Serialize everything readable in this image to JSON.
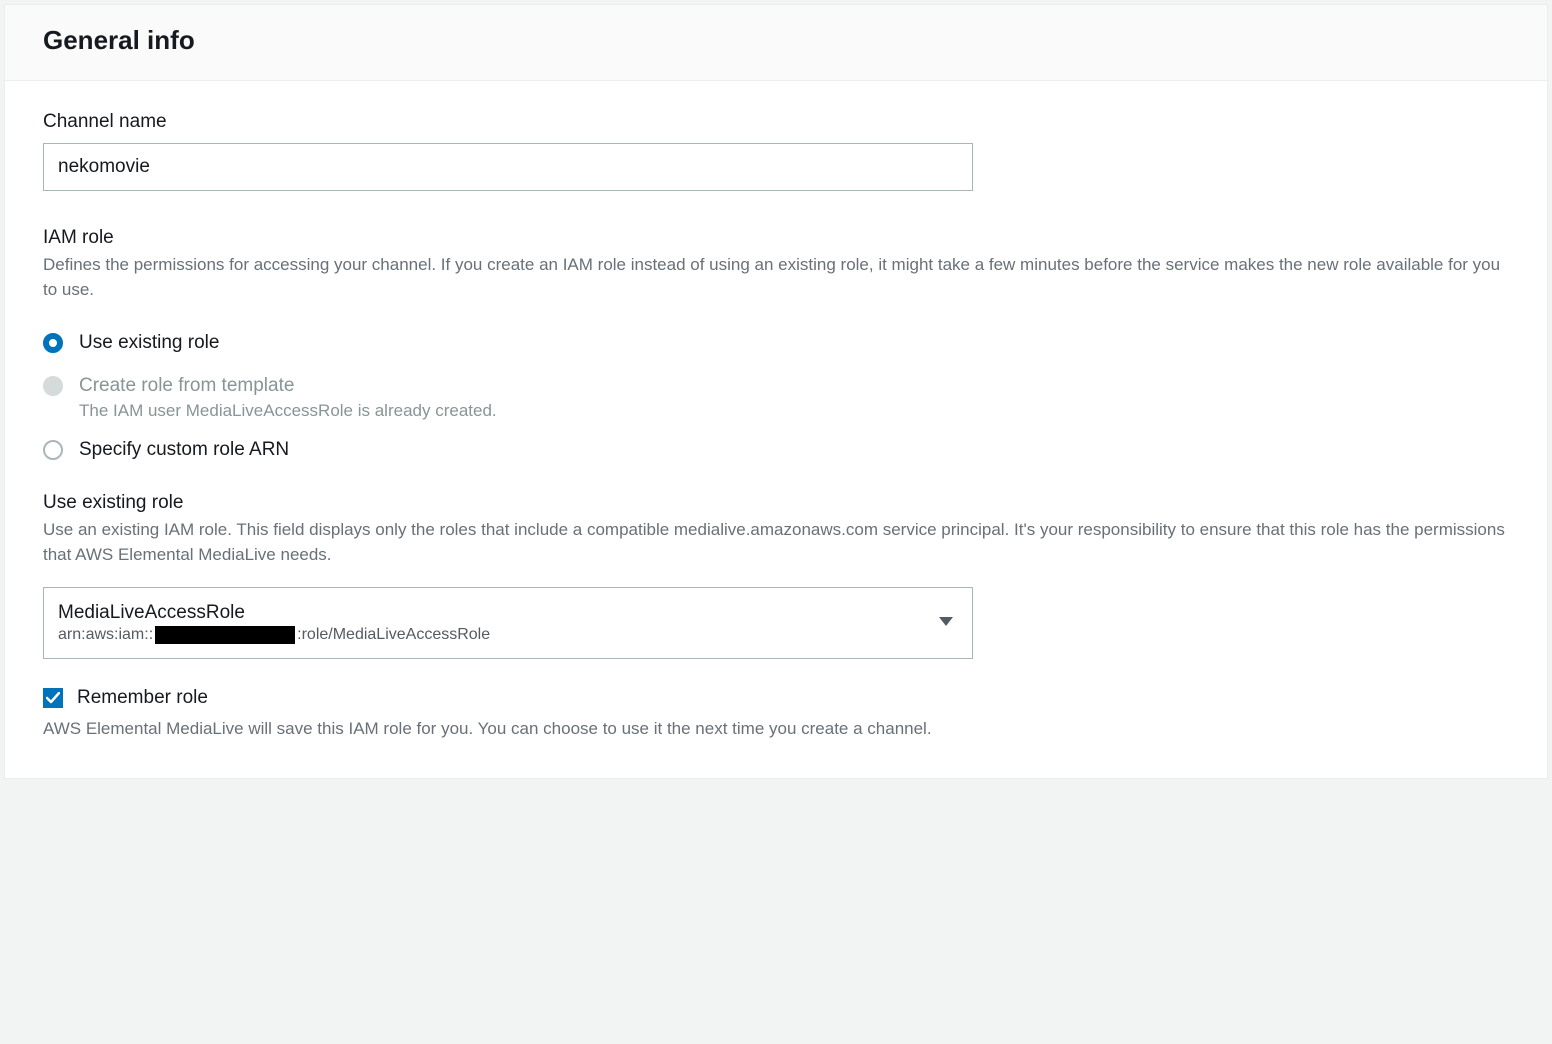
{
  "header": {
    "title": "General info"
  },
  "channel_name": {
    "label": "Channel name",
    "value": "nekomovie"
  },
  "iam_role": {
    "label": "IAM role",
    "description": "Defines the permissions for accessing your channel. If you create an IAM role instead of using an existing role, it might take a few minutes before the service makes the new role available for you to use.",
    "options": {
      "existing": {
        "label": "Use existing role",
        "selected": true
      },
      "template": {
        "label": "Create role from template",
        "sub": "The IAM user MediaLiveAccessRole is already created.",
        "disabled": true
      },
      "custom": {
        "label": "Specify custom role ARN"
      }
    }
  },
  "existing_role": {
    "label": "Use existing role",
    "description": "Use an existing IAM role. This field displays only the roles that include a compatible medialive.amazonaws.com service principal. It's your responsibility to ensure that this role has the permissions that AWS Elemental MediaLive needs.",
    "select": {
      "primary": "MediaLiveAccessRole",
      "secondary_prefix": "arn:aws:iam::",
      "secondary_suffix": ":role/MediaLiveAccessRole"
    }
  },
  "remember": {
    "label": "Remember role",
    "checked": true,
    "helper": "AWS Elemental MediaLive will save this IAM role for you. You can choose to use it the next time you create a channel."
  }
}
